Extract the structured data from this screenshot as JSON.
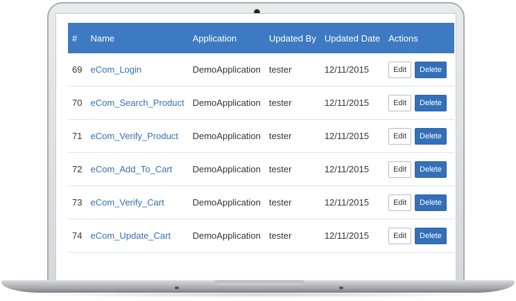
{
  "table": {
    "headers": {
      "id": "#",
      "name": "Name",
      "application": "Application",
      "updated_by": "Updated By",
      "updated_date": "Updated Date",
      "actions": "Actions"
    },
    "rows": [
      {
        "id": "69",
        "name": "eCom_Login",
        "application": "DemoApplication",
        "updated_by": "tester",
        "updated_date": "12/11/2015"
      },
      {
        "id": "70",
        "name": "eCom_Search_Product",
        "application": "DemoApplication",
        "updated_by": "tester",
        "updated_date": "12/11/2015"
      },
      {
        "id": "71",
        "name": "eCom_Verify_Product",
        "application": "DemoApplication",
        "updated_by": "tester",
        "updated_date": "12/11/2015"
      },
      {
        "id": "72",
        "name": "eCom_Add_To_Cart",
        "application": "DemoApplication",
        "updated_by": "tester",
        "updated_date": "12/11/2015"
      },
      {
        "id": "73",
        "name": "eCom_Verify_Cart",
        "application": "DemoApplication",
        "updated_by": "tester",
        "updated_date": "12/11/2015"
      },
      {
        "id": "74",
        "name": "eCom_Update_Cart",
        "application": "DemoApplication",
        "updated_by": "tester",
        "updated_date": "12/11/2015"
      }
    ],
    "actions": {
      "edit_label": "Edit",
      "delete_label": "Delete"
    }
  },
  "colors": {
    "header_bg": "#3d7ac2",
    "link": "#3470b0",
    "delete_bg": "#3470b8"
  }
}
